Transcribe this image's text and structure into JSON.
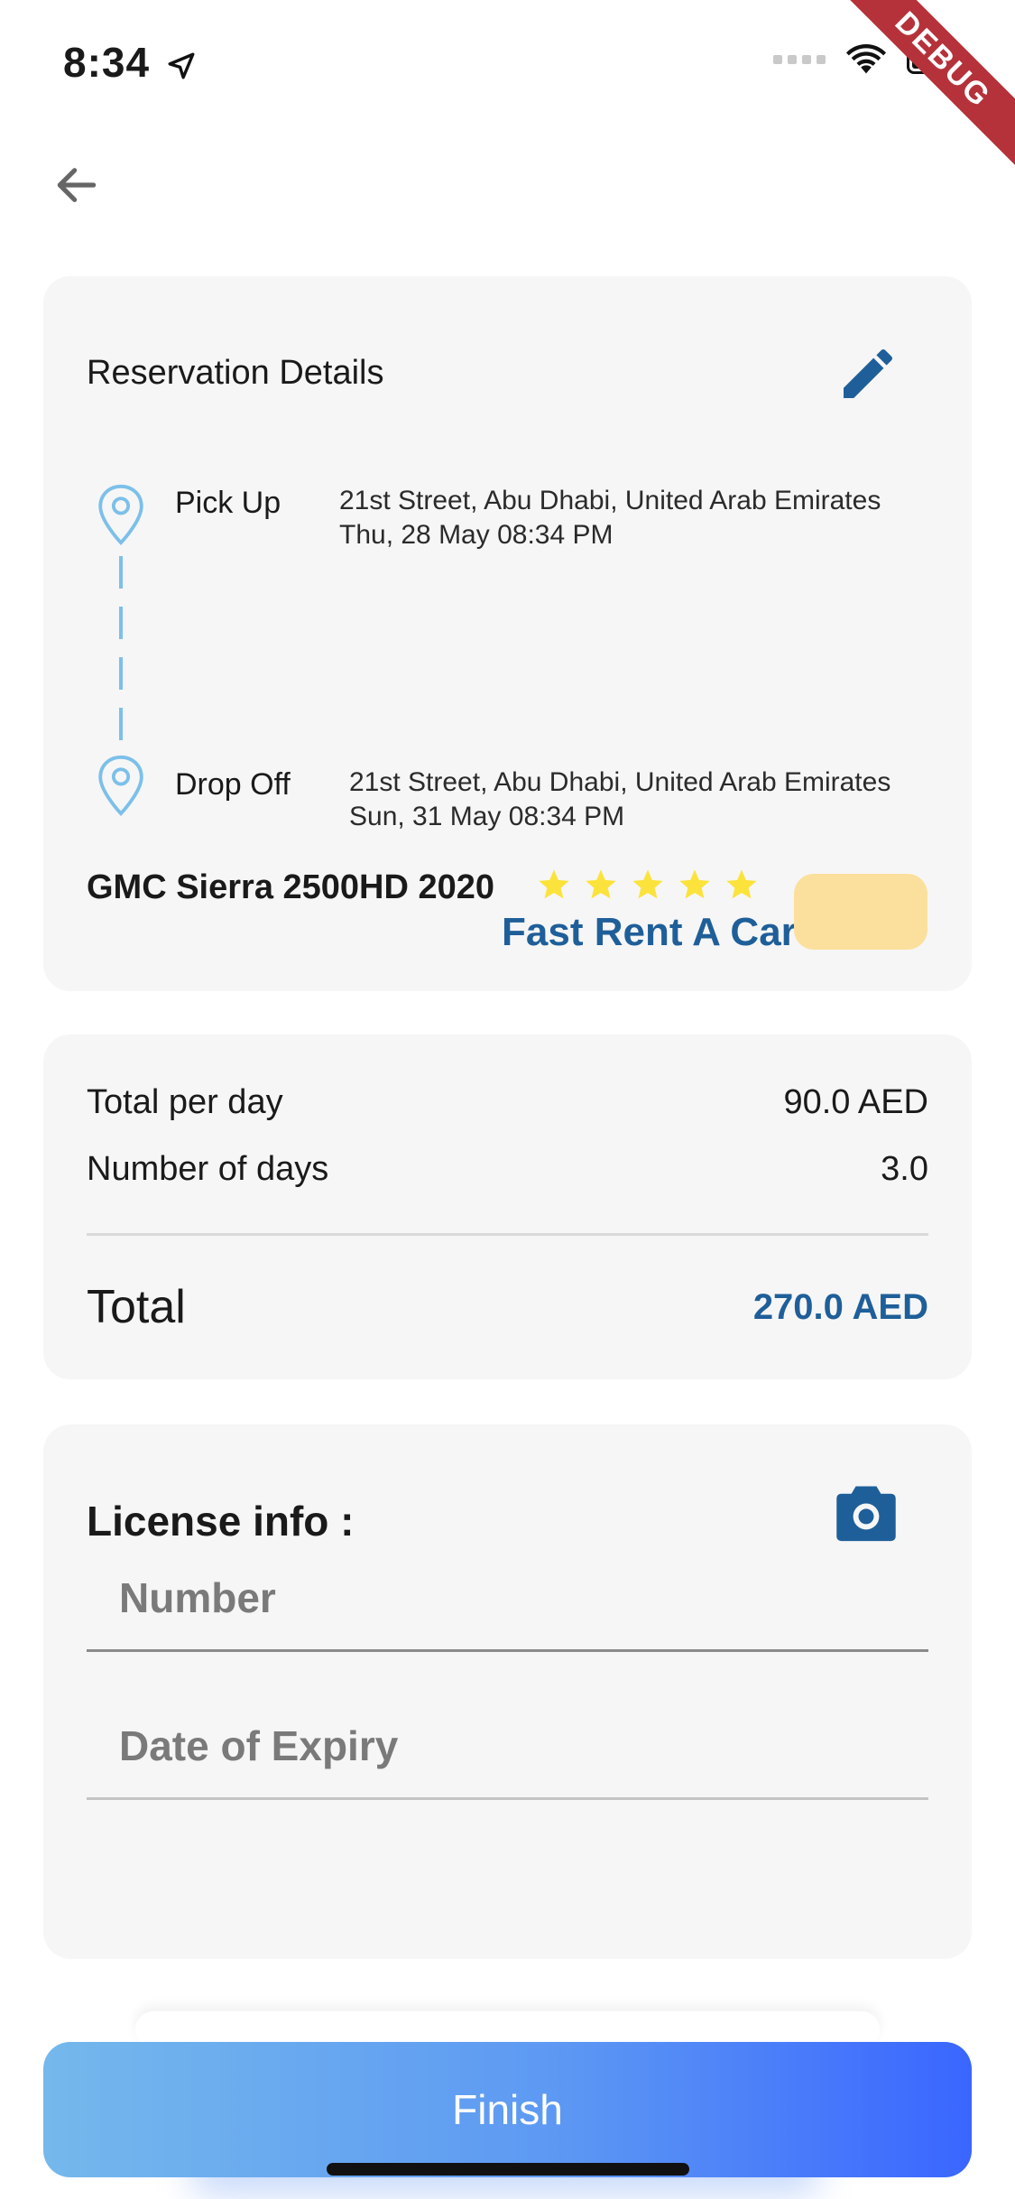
{
  "status_bar": {
    "time": "8:34"
  },
  "debug_banner": "DEBUG",
  "reservation": {
    "title": "Reservation Details",
    "pickup": {
      "label": "Pick Up",
      "address": "21st Street, Abu Dhabi, United Arab Emirates",
      "datetime": "Thu, 28 May 08:34 PM"
    },
    "dropoff": {
      "label": "Drop Off",
      "address": "21st Street, Abu Dhabi, United Arab Emirates",
      "datetime": "Sun, 31 May 08:34 PM"
    },
    "car_name": "GMC Sierra 2500HD 2020",
    "rating": 5,
    "agency": "Fast Rent A Car"
  },
  "totals": {
    "per_day_label": "Total per day",
    "per_day_value": "90.0 AED",
    "days_label": "Number of days",
    "days_value": "3.0",
    "total_label": "Total",
    "total_value": "270.0 AED"
  },
  "license": {
    "title": "License info :",
    "number_placeholder": "Number",
    "expiry_placeholder": "Date of Expiry"
  },
  "finish_label": "Finish",
  "colors": {
    "accent": "#1f5f99",
    "star": "#fbe33c",
    "pin": "#7cc0ea",
    "badge": "#fbe09d",
    "finish_start": "#74b8ec",
    "finish_end": "#3a66ff"
  }
}
